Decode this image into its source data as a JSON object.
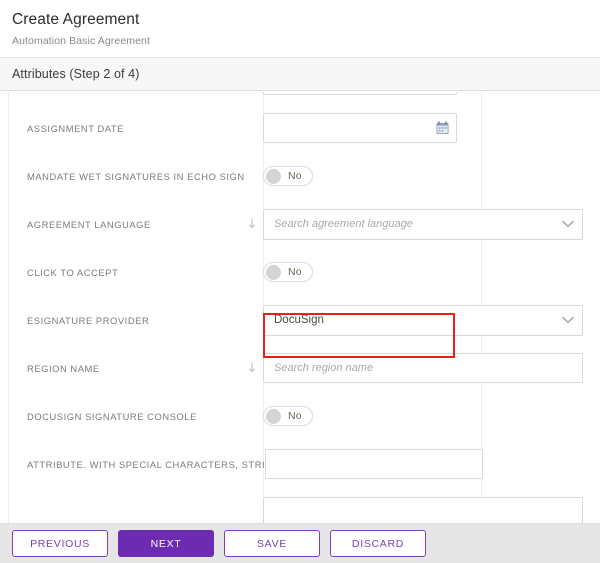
{
  "header": {
    "title": "Create Agreement",
    "subtitle": "Automation Basic Agreement"
  },
  "step_bar": {
    "title": "Attributes (Step 2 of 4)",
    "current_step": 2,
    "total_steps": 4
  },
  "form": {
    "fields": [
      {
        "label": "",
        "type": "text",
        "value": "",
        "placeholder": "",
        "clipped": true
      },
      {
        "label": "ASSIGNMENT DATE",
        "type": "date",
        "value": "",
        "placeholder": "",
        "icon": "calendar-icon"
      },
      {
        "label": "MANDATE WET SIGNATURES IN ECHO SIGN",
        "type": "toggle",
        "value": "No"
      },
      {
        "label": "AGREEMENT LANGUAGE",
        "type": "select",
        "value": "",
        "placeholder": "Search agreement language",
        "indent_icon": "arrow-down-indent-icon"
      },
      {
        "label": "CLICK TO ACCEPT",
        "type": "toggle",
        "value": "No"
      },
      {
        "label": "ESIGNATURE PROVIDER",
        "type": "select",
        "value": "DocuSign",
        "placeholder": "",
        "highlighted": true
      },
      {
        "label": "REGION NAME",
        "type": "text",
        "value": "",
        "placeholder": "Search region name",
        "indent_icon": "arrow-down-indent-icon"
      },
      {
        "label": "DOCUSIGN SIGNATURE CONSOLE",
        "type": "toggle",
        "value": "No"
      },
      {
        "label": "ATTRIBUTE. WITH SPECIAL CHARACTERS, STRING",
        "type": "text",
        "value": "",
        "placeholder": ""
      }
    ]
  },
  "annotation": {
    "color": "#f01d1d",
    "target": "esignature-provider-select"
  },
  "footer": {
    "buttons": [
      {
        "label": "PREVIOUS",
        "style": "outline"
      },
      {
        "label": "NEXT",
        "style": "primary"
      },
      {
        "label": "SAVE",
        "style": "outline"
      },
      {
        "label": "DISCARD",
        "style": "outline"
      }
    ]
  },
  "colors": {
    "primary_purple": "#6c2bb0",
    "outline_purple": "#7c3fb5",
    "annotation_red": "#f01d1d",
    "footer_bg": "#e6e6e6",
    "stepbar_bg": "#f7f7f7",
    "label_gray": "#7b7b7b"
  }
}
